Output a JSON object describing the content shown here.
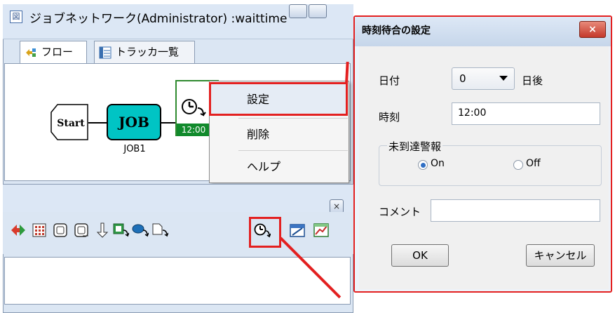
{
  "main_window": {
    "title": "ジョブネットワーク(Administrator) :waittime",
    "tabs": [
      {
        "label": "フロー",
        "icon": "flow-icon"
      },
      {
        "label": "トラッカ一覧",
        "icon": "tracker-list-icon"
      }
    ]
  },
  "flow": {
    "start_label": "Start",
    "job_label": "JOB",
    "job_caption": "JOB1",
    "wait_time": "12:00"
  },
  "context_menu": {
    "items": [
      "設定",
      "削除",
      "ヘルプ"
    ],
    "highlighted": "設定"
  },
  "palette": {
    "close_symbol": "×",
    "icons": [
      "enter-exit-icon",
      "job-grid-icon",
      "unit-job-icon",
      "unit-job-return-icon",
      "down-arrow-icon",
      "jnw-wait-icon",
      "job-wait-icon",
      "file-wait-icon",
      "time-wait-icon",
      "calendar-icon",
      "chart-icon"
    ],
    "highlighted_icon": "time-wait-icon"
  },
  "dialog": {
    "title": "時刻待合の設定",
    "close_symbol": "×",
    "date_label": "日付",
    "date_value": "0",
    "date_suffix": "日後",
    "time_label": "時刻",
    "time_value": "12:00",
    "alarm_group_label": "未到達警報",
    "radio_on": "On",
    "radio_off": "Off",
    "radio_selected": "On",
    "comment_label": "コメント",
    "comment_value": "",
    "ok_label": "OK",
    "cancel_label": "キャンセル"
  },
  "colors": {
    "highlight_red": "#e32020",
    "job_node_fill": "#00c4c4",
    "wait_badge_green": "#118a2c",
    "window_frame": "#dbe6f3"
  }
}
